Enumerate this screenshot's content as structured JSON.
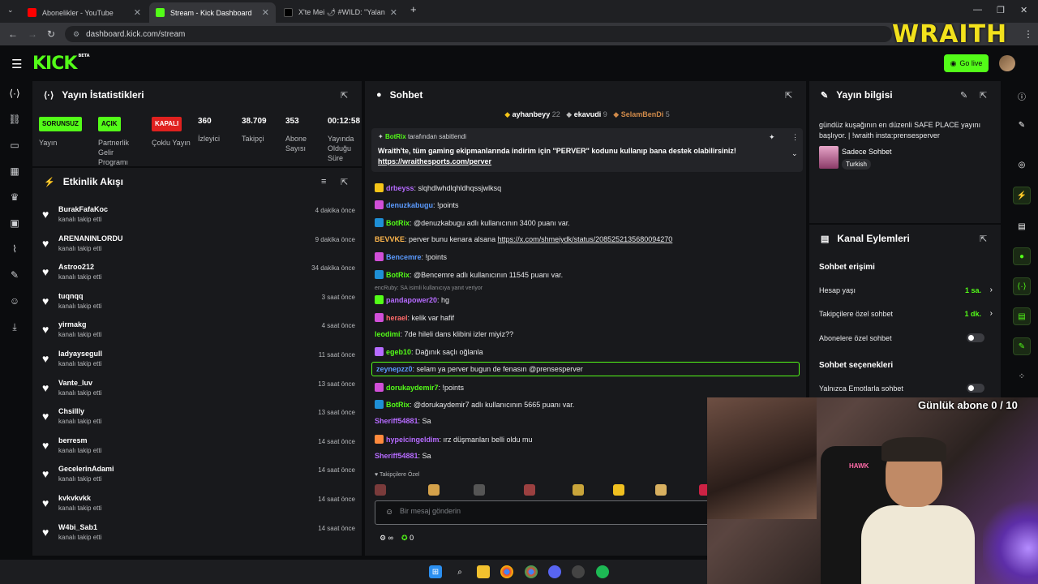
{
  "browser": {
    "tabs": [
      {
        "title": "Abonelikler - YouTube",
        "favicon_color": "#ff0000"
      },
      {
        "title": "Stream - Kick Dashboard",
        "favicon_color": "#53fc18"
      },
      {
        "title": "X'te Mei 🌶 #WILD: \"Yalan yanl",
        "favicon_color": "#000000"
      }
    ],
    "url": "dashboard.kick.com/stream"
  },
  "header": {
    "logo": "KICK",
    "logo_beta": "BETA",
    "go_live_label": "Go live",
    "overlay_brand": "WRAITH"
  },
  "stats": {
    "title": "Yayın İstatistikleri",
    "items": [
      {
        "badge": "SORUNSUZ",
        "badge_color": "#53fc18",
        "label": "Yayın"
      },
      {
        "badge": "AÇIK",
        "badge_color": "#53fc18",
        "label": "Partnerlik Gelir Programı"
      },
      {
        "badge": "KAPALI",
        "badge_color": "#e0211f",
        "label": "Çoklu Yayın"
      },
      {
        "value": "360",
        "label": "İzleyici"
      },
      {
        "value": "38.709",
        "label": "Takipçi"
      },
      {
        "value": "353",
        "label": "Abone Sayısı"
      },
      {
        "value": "00:12:58",
        "label": "Yayında Olduğu Süre"
      }
    ]
  },
  "activity": {
    "title": "Etkinlik Akışı",
    "items": [
      {
        "name": "BurakFafaKoc",
        "sub": "kanalı takip etti",
        "time": "4 dakika önce"
      },
      {
        "name": "ARENANINLORDU",
        "sub": "kanalı takip etti",
        "time": "9 dakika önce"
      },
      {
        "name": "Astroo212",
        "sub": "kanalı takip etti",
        "time": "34 dakika önce"
      },
      {
        "name": "tuqnqq",
        "sub": "kanalı takip etti",
        "time": "3 saat önce"
      },
      {
        "name": "yirmakg",
        "sub": "kanalı takip etti",
        "time": "4 saat önce"
      },
      {
        "name": "ladyaysegull",
        "sub": "kanalı takip etti",
        "time": "11 saat önce"
      },
      {
        "name": "Vante_luv",
        "sub": "kanalı takip etti",
        "time": "13 saat önce"
      },
      {
        "name": "Chsillly",
        "sub": "kanalı takip etti",
        "time": "13 saat önce"
      },
      {
        "name": "berresm",
        "sub": "kanalı takip etti",
        "time": "14 saat önce"
      },
      {
        "name": "GecelerinAdami",
        "sub": "kanalı takip etti",
        "time": "14 saat önce"
      },
      {
        "name": "kvkvkvkk",
        "sub": "kanalı takip etti",
        "time": "14 saat önce"
      },
      {
        "name": "W4bi_Sab1",
        "sub": "kanalı takip etti",
        "time": "14 saat önce"
      }
    ]
  },
  "chat": {
    "title": "Sohbet",
    "gifters": [
      {
        "name": "ayhanbeyy",
        "count": "22"
      },
      {
        "name": "ekavudi",
        "count": "9"
      },
      {
        "name": "SelamBenDi",
        "count": "5"
      }
    ],
    "pinned": {
      "by_user": "BotRix",
      "by_text": "tarafından sabitlendi",
      "message": "Wraith'te, tüm gaming ekipmanlarında indirim için \"PERVER\" kodunu kullanıp bana destek olabilirsiniz!",
      "link": "https://wraithesports.com/perver"
    },
    "messages": [
      {
        "user": "drbeyss",
        "color": "#b66bff",
        "badge": "#f5c518",
        "text": ": slqhdlwhdlqhldhqssjwlksq"
      },
      {
        "user": "denuzkabugu",
        "color": "#5b9bff",
        "badge": "#d14fd8",
        "text": ": !points"
      },
      {
        "user": "BotRix",
        "color": "#53fc18",
        "badge": "#1e8fd6",
        "text": ": @denuzkabugu adlı kullanıcının 3400 puanı var."
      },
      {
        "user": "BEVVKE",
        "color": "#ffb74d",
        "badge": "",
        "text": ": perver bunu kenara alsana ",
        "link": "https://x.com/shmeiydk/status/2085252135680094270"
      },
      {
        "user": "Bencemre",
        "color": "#5b9bff",
        "badge": "#d14fd8",
        "text": ": !points"
      },
      {
        "user": "BotRix",
        "color": "#53fc18",
        "badge": "#1e8fd6",
        "text": ": @Bencemre adlı kullanıcının 11545 puanı var."
      },
      {
        "user": "pandapower20",
        "color": "#b66bff",
        "badge": "#53fc18",
        "text": ": hg"
      },
      {
        "user": "herael",
        "color": "#ff6a6a",
        "badge": "#d14fd8",
        "text": ": kelik var hafif"
      },
      {
        "user": "leodimi",
        "color": "#53fc18",
        "badge": "",
        "text": ": 7de hileli dans klibini izler miyiz??"
      },
      {
        "user": "egeb10",
        "color": "#53fc18",
        "badge": "#b66bff",
        "text": ": Dağınık saçlı oğlanla"
      },
      {
        "user": "zeynepzz0",
        "color": "#5b9bff",
        "badge": "",
        "text": ": selam ya perver bugun de fenasın @prensesperver",
        "highlight": true
      },
      {
        "user": "dorukaydemir7",
        "color": "#53fc18",
        "badge": "#d14fd8",
        "text": ": !points"
      },
      {
        "user": "BotRix",
        "color": "#53fc18",
        "badge": "#1e8fd6",
        "text": ": @dorukaydemir7 adlı kullanıcının 5665 puanı var."
      },
      {
        "user": "Sheriff54881",
        "color": "#b66bff",
        "badge": "",
        "text": ": Sa"
      },
      {
        "user": "hypeicingeldim",
        "color": "#b66bff",
        "badge": "#ff8a3d",
        "text": ": ırz düşmanları belli oldu mu"
      },
      {
        "user": "Sheriff54881",
        "color": "#b66bff",
        "badge": "",
        "text": ": Sa"
      }
    ],
    "reply_hint": "encRuby: SA    isimli kullanıcıya yanıt veriyor",
    "followers_only_label": "♥ Takipçilere Özel",
    "input_placeholder": "Bir mesaj gönderin",
    "footer_points": "0",
    "footer_infinity": "∞"
  },
  "info": {
    "title": "Yayın bilgisi",
    "stream_title": "gündüz kuşağının en düzenli SAFE PLACE yayını başlıyor. | !wraith insta:prensesperver",
    "category": "Sadece Sohbet",
    "tag": "Turkish"
  },
  "channel_actions": {
    "title": "Kanal Eylemleri",
    "chat_access": "Sohbet erişimi",
    "account_age_label": "Hesap yaşı",
    "account_age_value": "1 sa.",
    "followers_only_label": "Takipçilere özel sohbet",
    "followers_only_value": "1 dk.",
    "subscribers_only_label": "Abonelere özel sohbet",
    "chat_options": "Sohbet seçenekleri",
    "emote_only_label": "Yalnızca Emotlarla sohbet"
  },
  "overlay": {
    "sub_goal": "Günlük abone 0 / 10",
    "chair_brand": "HAWK"
  }
}
